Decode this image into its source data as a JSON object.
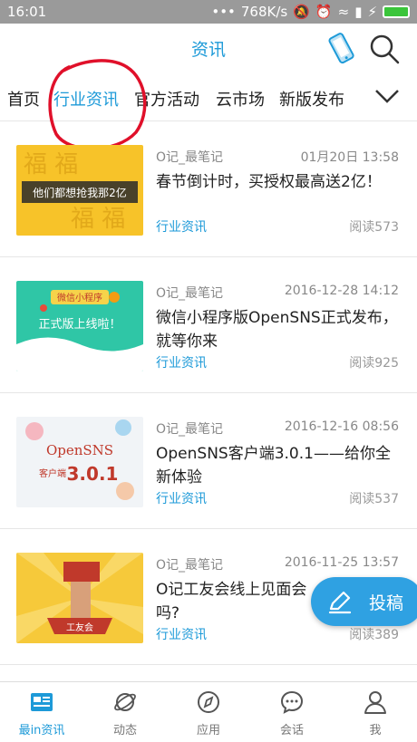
{
  "status_bar": {
    "time": "16:01",
    "network_speed": "768K/s"
  },
  "header": {
    "title": "资讯"
  },
  "tabs": [
    {
      "label": "首页",
      "active": false
    },
    {
      "label": "行业资讯",
      "active": true
    },
    {
      "label": "官方活动",
      "active": false
    },
    {
      "label": "云市场",
      "active": false
    },
    {
      "label": "新版发布",
      "active": false
    }
  ],
  "articles": [
    {
      "author": "O记_最笔记",
      "date": "01月20日 13:58",
      "title": "春节倒计时，买授权最高送2亿！",
      "category": "行业资讯",
      "reads": "阅读573",
      "thumb_text": "他们都想抢我那2亿"
    },
    {
      "author": "O记_最笔记",
      "date": "2016-12-28 14:12",
      "title": "微信小程序版OpenSNS正式发布，就等你来",
      "category": "行业资讯",
      "reads": "阅读925",
      "thumb_text": "微信小程序",
      "thumb_text2": "正式版上线啦！"
    },
    {
      "author": "O记_最笔记",
      "date": "2016-12-16 08:56",
      "title": "OpenSNS客户端3.0.1——给你全新体验",
      "category": "行业资讯",
      "reads": "阅读537",
      "thumb_text": "OpenSNS",
      "thumb_text2": "客户端",
      "thumb_text3": "3.0.1"
    },
    {
      "author": "O记_最笔记",
      "date": "2016-11-25 13:57",
      "title": "O记工友会线上见面会吗?",
      "category": "行业资讯",
      "reads": "阅读389",
      "thumb_text": "工友会"
    }
  ],
  "fab": {
    "label": "投稿"
  },
  "bottom_nav": [
    {
      "label": "最in资讯",
      "active": true
    },
    {
      "label": "动态",
      "active": false
    },
    {
      "label": "应用",
      "active": false
    },
    {
      "label": "会话",
      "active": false
    },
    {
      "label": "我",
      "active": false
    }
  ],
  "colors": {
    "accent": "#1d9ad8",
    "annotation": "#e0102a",
    "status_bar": "#9a9a9a"
  }
}
